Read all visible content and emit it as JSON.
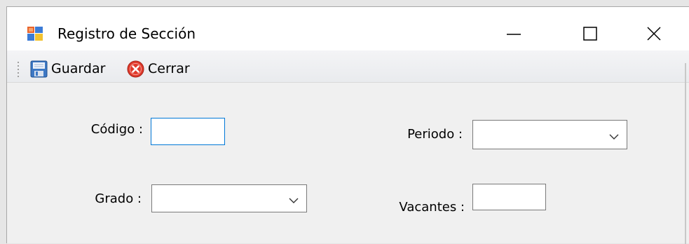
{
  "window": {
    "title": "Registro de Sección"
  },
  "toolbar": {
    "guardar_label": "Guardar",
    "cerrar_label": "Cerrar"
  },
  "form": {
    "codigo_label": "Código :",
    "codigo_value": "",
    "periodo_label": "Periodo :",
    "periodo_value": "",
    "grado_label": "Grado :",
    "grado_value": "",
    "vacantes_label": "Vacantes :",
    "vacantes_value": ""
  },
  "colors": {
    "focus_border": "#0078d7",
    "close_icon_red": "#e0392b",
    "save_icon_blue": "#2b6cb0"
  },
  "icons": {
    "app": "form-app-icon",
    "save": "floppy-disk-icon",
    "close": "red-x-circle-icon"
  }
}
